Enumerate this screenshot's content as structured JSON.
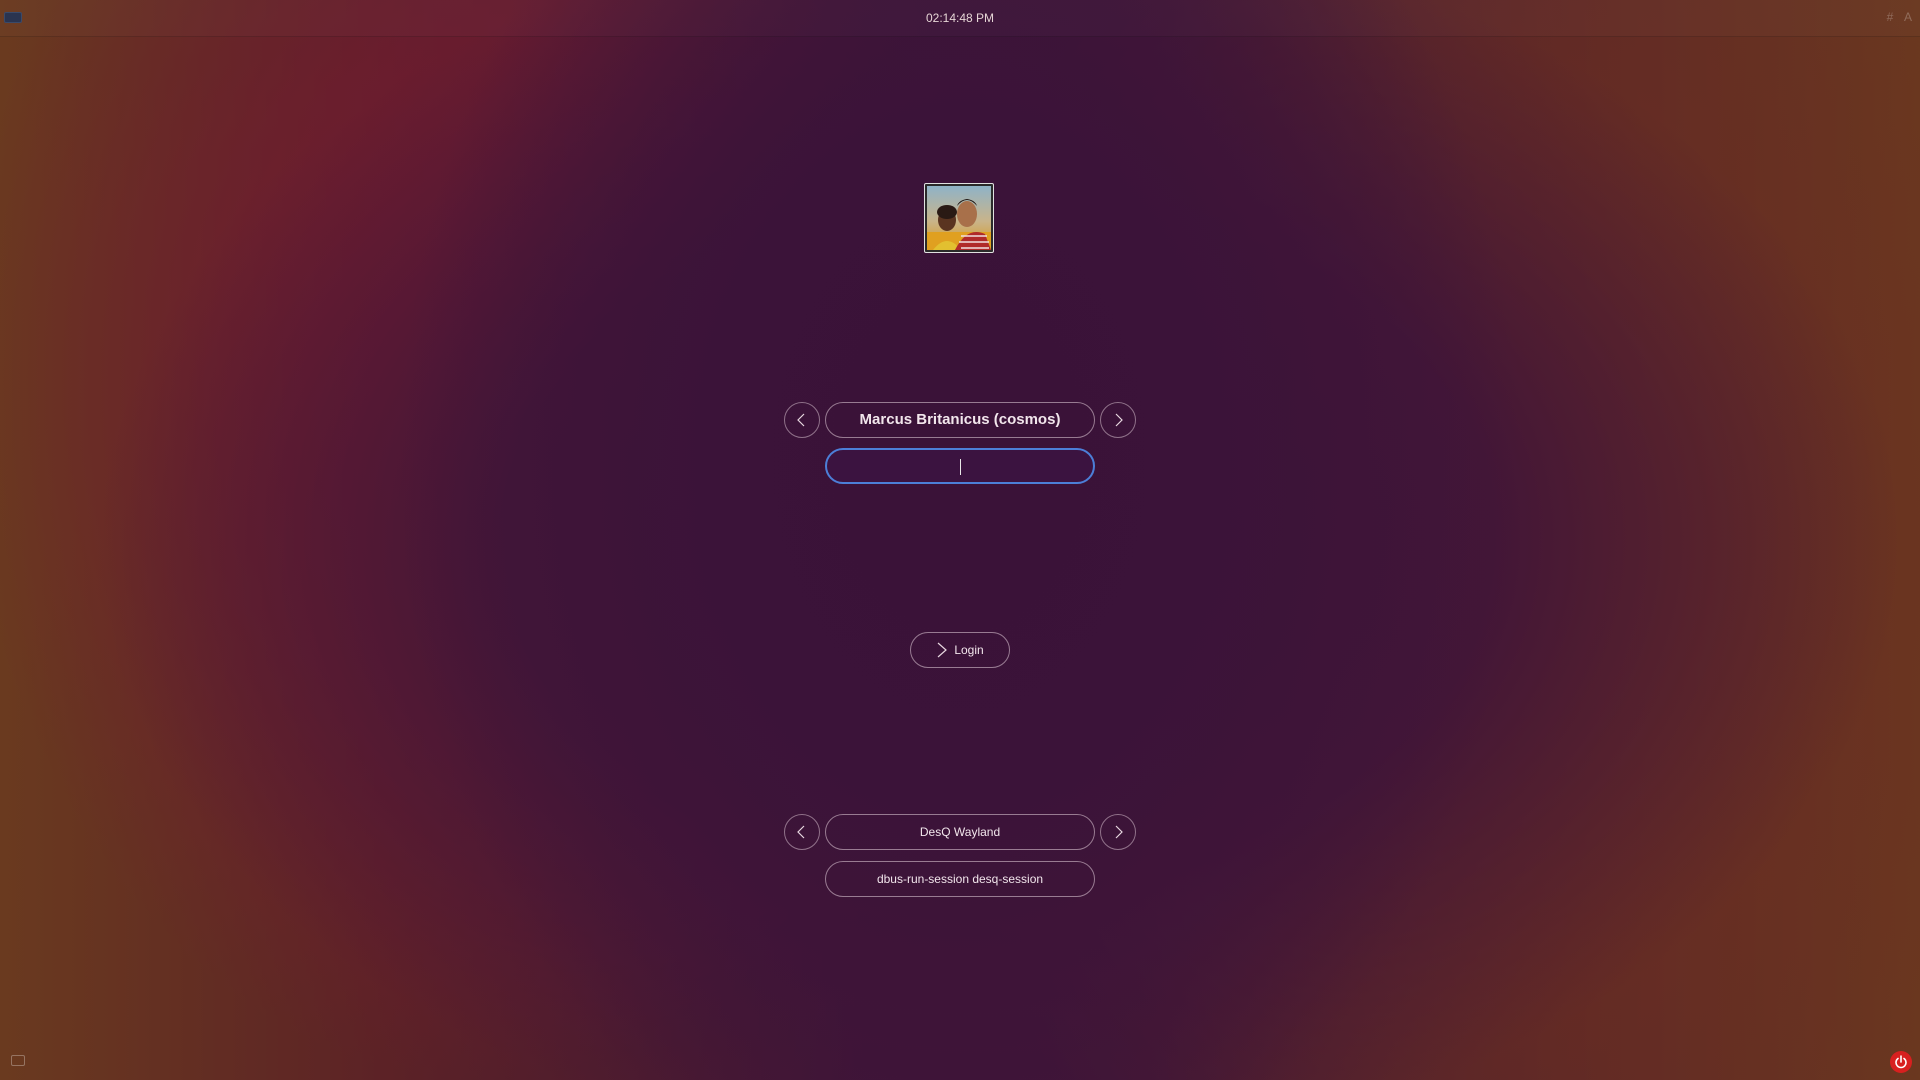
{
  "topbar": {
    "clock": "02:14:48 PM",
    "keyboard_icon": "keyboard-icon",
    "right_icons": "# A"
  },
  "user": {
    "display_name": "Marcus Britanicus (cosmos)",
    "avatar_icon": "user-avatar",
    "prev_icon": "chevron-left-icon",
    "next_icon": "chevron-right-icon"
  },
  "password": {
    "value": "",
    "placeholder": ""
  },
  "login": {
    "label": "Login",
    "icon": "chevron-right-icon"
  },
  "session": {
    "name": "DesQ Wayland",
    "command": "dbus-run-session desq-session",
    "prev_icon": "chevron-left-icon",
    "next_icon": "chevron-right-icon"
  },
  "footer": {
    "message_icon": "message-icon",
    "power_icon": "power-icon",
    "power_color": "#d8201f",
    "focus_color": "#4c7fd8"
  }
}
